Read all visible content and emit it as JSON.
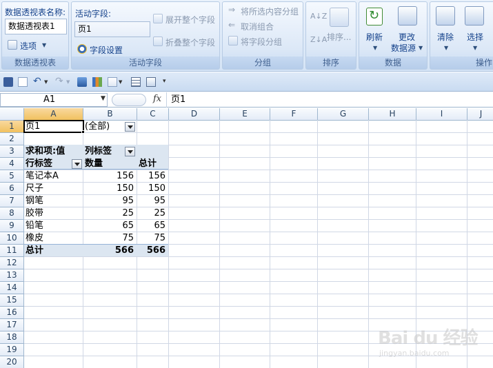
{
  "ribbon": {
    "pivot_group": {
      "name_label": "数据透视表名称:",
      "name_value": "数据透视表1",
      "options_label": "选项",
      "group_label": "数据透视表"
    },
    "active_field_group": {
      "label": "活动字段:",
      "field_value": "页1",
      "field_settings_label": "字段设置",
      "expand_label": "展开整个字段",
      "collapse_label": "折叠整个字段",
      "group_label": "活动字段"
    },
    "group_group": {
      "group_selection_label": "将所选内容分组",
      "ungroup_label": "取消组合",
      "group_field_label": "将字段分组",
      "group_label": "分组"
    },
    "sort_group": {
      "sort_label": "排序...",
      "group_label": "排序"
    },
    "data_group": {
      "refresh_label": "刷新",
      "change_source_label_1": "更改",
      "change_source_label_2": "数据源",
      "group_label": "数据"
    },
    "actions_group": {
      "clear_label": "清除",
      "select_label": "选择",
      "group_label": "操作"
    }
  },
  "formula_bar": {
    "name_box": "A1",
    "fx": "fx",
    "formula": "页1"
  },
  "columns": [
    "A",
    "B",
    "C",
    "D",
    "E",
    "F",
    "G",
    "H",
    "I",
    "J"
  ],
  "rows": [
    "1",
    "2",
    "3",
    "4",
    "5",
    "6",
    "7",
    "8",
    "9",
    "10",
    "11",
    "12",
    "13",
    "14",
    "15",
    "16",
    "17",
    "18",
    "19",
    "20"
  ],
  "cells": {
    "A1": "页1",
    "B1": "(全部)",
    "A3": "求和项:值",
    "B3": "列标签",
    "A4": "行标签",
    "B4": "数量",
    "C4": "总计",
    "A5": "笔记本A",
    "B5": "156",
    "C5": "156",
    "A6": "尺子",
    "B6": "150",
    "C6": "150",
    "A7": "钢笔",
    "B7": "95",
    "C7": "95",
    "A8": "胶带",
    "B8": "25",
    "C8": "25",
    "A9": "铅笔",
    "B9": "65",
    "C9": "65",
    "A10": "橡皮",
    "B10": "75",
    "C10": "75",
    "A11": "总计",
    "B11": "566",
    "C11": "566"
  },
  "watermark": {
    "logo": "Bai du 经验",
    "url": "jingyan.baidu.com"
  }
}
